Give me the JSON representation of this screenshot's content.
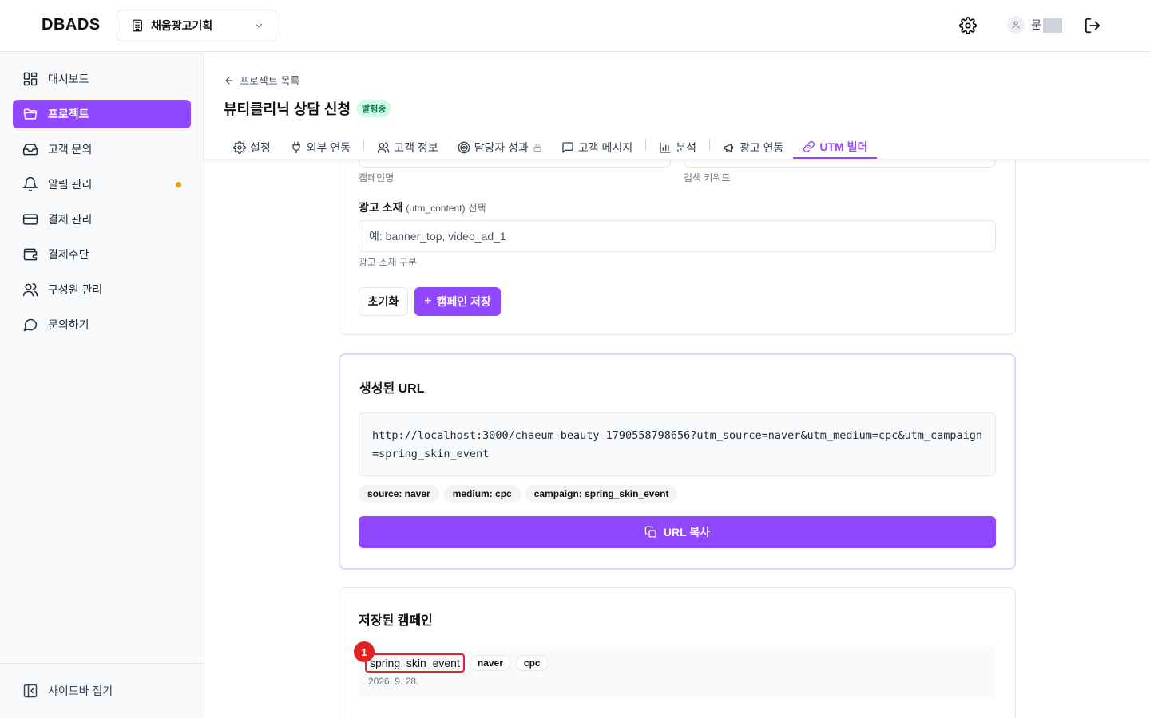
{
  "app": {
    "logo": "DBADS",
    "org_name": "채움광고기획",
    "user_initial": "문"
  },
  "sidebar": {
    "items": [
      {
        "label": "대시보드",
        "icon": "dashboard-icon"
      },
      {
        "label": "프로젝트",
        "icon": "folder-icon",
        "active": true
      },
      {
        "label": "고객 문의",
        "icon": "inbox-icon"
      },
      {
        "label": "알림 관리",
        "icon": "bell-icon",
        "dot": true
      },
      {
        "label": "결제 관리",
        "icon": "credit-card-icon"
      },
      {
        "label": "결제수단",
        "icon": "wallet-icon"
      },
      {
        "label": "구성원 관리",
        "icon": "users-icon"
      },
      {
        "label": "문의하기",
        "icon": "chat-icon"
      }
    ],
    "collapse_label": "사이드바 접기"
  },
  "page": {
    "breadcrumb": "프로젝트 목록",
    "title": "뷰티클리닉 상담 신청",
    "status": "발행중"
  },
  "tabs": [
    {
      "label": "설정",
      "icon": "gear-icon"
    },
    {
      "label": "외부 연동",
      "icon": "plug-icon"
    },
    {
      "label": "고객 정보",
      "icon": "users-icon"
    },
    {
      "label": "담당자 성과",
      "icon": "target-icon",
      "locked": true
    },
    {
      "label": "고객 메시지",
      "icon": "message-icon"
    },
    {
      "label": "분석",
      "icon": "bar-chart-icon"
    },
    {
      "label": "광고 연동",
      "icon": "megaphone-icon"
    },
    {
      "label": "UTM 빌더",
      "icon": "link-icon",
      "active": true
    }
  ],
  "form": {
    "campaign_help": "캠페인명",
    "keyword_help": "검색 키워드",
    "content_label": "광고 소재",
    "content_param": "(utm_content)",
    "content_optional": "선택",
    "content_placeholder": "예: banner_top, video_ad_1",
    "content_help": "광고 소재 구분",
    "reset_label": "초기화",
    "save_label": "캠페인 저장"
  },
  "generated": {
    "title": "생성된 URL",
    "url": "http://localhost:3000/chaeum-beauty-1790558798656?utm_source=naver&utm_medium=cpc&utm_campaign=spring_skin_event",
    "chips": [
      "source: naver",
      "medium: cpc",
      "campaign: spring_skin_event"
    ],
    "copy_label": "URL 복사"
  },
  "saved": {
    "title": "저장된 캠페인",
    "campaigns": [
      {
        "name": "spring_skin_event",
        "source": "naver",
        "medium": "cpc",
        "date": "2026. 9. 28."
      }
    ],
    "marker": "1"
  },
  "colors": {
    "accent": "#9146ff",
    "status_bg": "#d1fae5",
    "status_text": "#047857",
    "marker": "#e02424",
    "notif_dot": "#f59e0b"
  }
}
